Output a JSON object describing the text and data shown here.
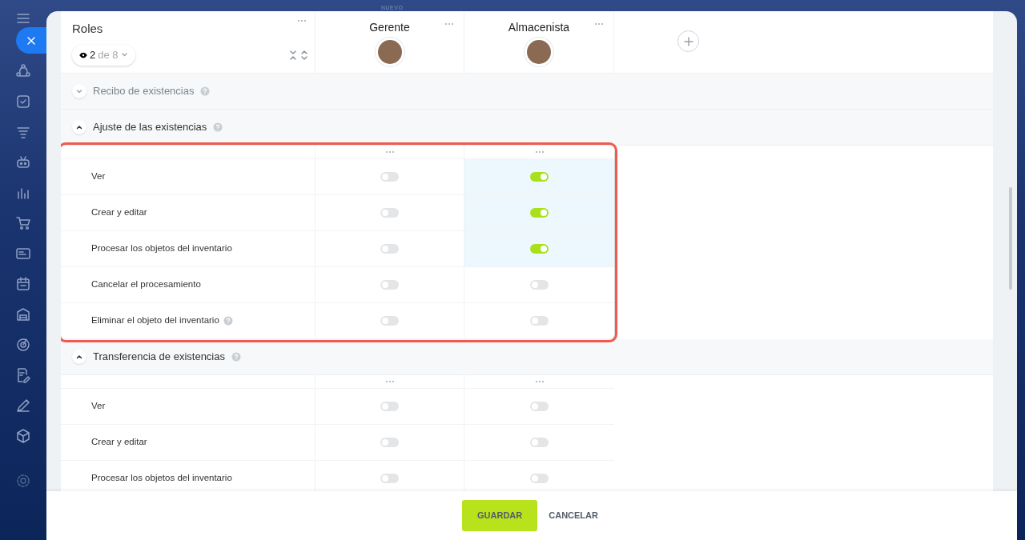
{
  "top_tab": {
    "label": "NUEVO"
  },
  "roles_column": {
    "title": "Roles",
    "filter": {
      "count": "2",
      "total": "de 8"
    }
  },
  "roles": [
    {
      "name": "Gerente"
    },
    {
      "name": "Almacenista"
    }
  ],
  "sections": [
    {
      "title": "Recibo de existencias",
      "expanded": false
    },
    {
      "title": "Ajuste de las existencias",
      "expanded": true,
      "highlighted": true,
      "rows": [
        {
          "label": "Ver",
          "help": false,
          "cells": [
            {
              "on": false
            },
            {
              "on": true
            }
          ]
        },
        {
          "label": "Crear y editar",
          "help": false,
          "cells": [
            {
              "on": false
            },
            {
              "on": true
            }
          ]
        },
        {
          "label": "Procesar los objetos del inventario",
          "help": false,
          "cells": [
            {
              "on": false
            },
            {
              "on": true
            }
          ]
        },
        {
          "label": "Cancelar el procesamiento",
          "help": false,
          "cells": [
            {
              "on": false
            },
            {
              "on": false
            }
          ]
        },
        {
          "label": "Eliminar el objeto del inventario",
          "help": true,
          "cells": [
            {
              "on": false
            },
            {
              "on": false
            }
          ]
        }
      ]
    },
    {
      "title": "Transferencia de existencias",
      "expanded": true,
      "rows": [
        {
          "label": "Ver",
          "help": false,
          "cells": [
            {
              "on": false
            },
            {
              "on": false
            }
          ]
        },
        {
          "label": "Crear y editar",
          "help": false,
          "cells": [
            {
              "on": false
            },
            {
              "on": false
            }
          ]
        },
        {
          "label": "Procesar los objetos del inventario",
          "help": false,
          "cells": [
            {
              "on": false
            },
            {
              "on": false
            }
          ]
        }
      ]
    }
  ],
  "footer": {
    "buttons": [
      {
        "label": "GUARDAR",
        "kind": "primary"
      },
      {
        "label": "CANCELAR",
        "kind": "link"
      }
    ]
  }
}
